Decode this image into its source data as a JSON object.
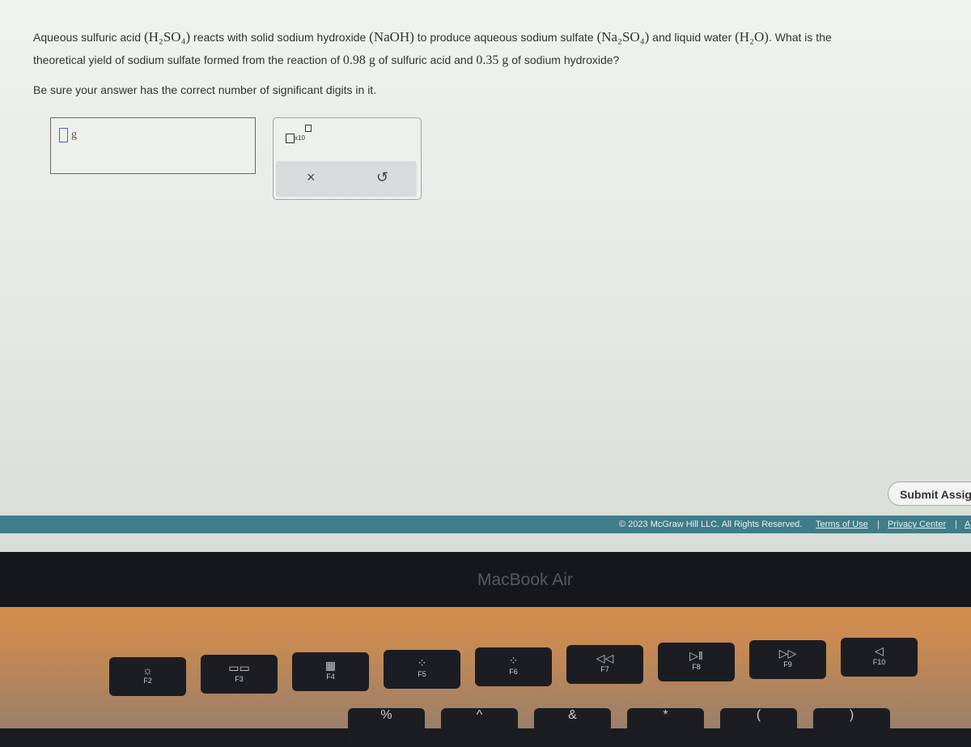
{
  "question": {
    "line1_a": "Aqueous sulfuric acid ",
    "acid_formula": "(H₂SO₄)",
    "line1_b": " reacts with solid sodium hydroxide ",
    "base_formula": "(NaOH)",
    "line1_c": " to produce aqueous sodium sulfate ",
    "salt_formula": "(Na₂SO₄)",
    "line1_d": " and liquid water ",
    "water_formula": "(H₂O)",
    "line1_e": ". What is the",
    "line2_a": "theoretical yield of sodium sulfate formed from the reaction of ",
    "mass_acid": "0.98 g",
    "line2_b": " of sulfuric acid and ",
    "mass_base": "0.35 g",
    "line2_c": " of sodium hydroxide?",
    "instruction": "Be sure your answer has the correct number of significant digits in it."
  },
  "answer": {
    "value": "",
    "unit": "g"
  },
  "tools": {
    "exponent_label": "x10",
    "clear_icon": "×",
    "reset_icon": "↺"
  },
  "submit_label": "Submit Assig",
  "footer": {
    "copyright": "© 2023 McGraw Hill LLC. All Rights Reserved.",
    "terms": "Terms of Use",
    "privacy": "Privacy Center",
    "more": "A",
    "sep": "|"
  },
  "laptop_brand": "MacBook Air",
  "keys": [
    {
      "label": "F2",
      "icon": "☼"
    },
    {
      "label": "F3",
      "icon": "▭▭"
    },
    {
      "label": "F4",
      "icon": "▦"
    },
    {
      "label": "F5",
      "icon": "⁘"
    },
    {
      "label": "F6",
      "icon": "⁘"
    },
    {
      "label": "F7",
      "icon": "◁◁"
    },
    {
      "label": "F8",
      "icon": "▷‖"
    },
    {
      "label": "F9",
      "icon": "▷▷"
    },
    {
      "label": "F10",
      "icon": "◁"
    }
  ],
  "bottom_keys": [
    "%",
    "^",
    "&",
    "*",
    "(",
    ")"
  ]
}
